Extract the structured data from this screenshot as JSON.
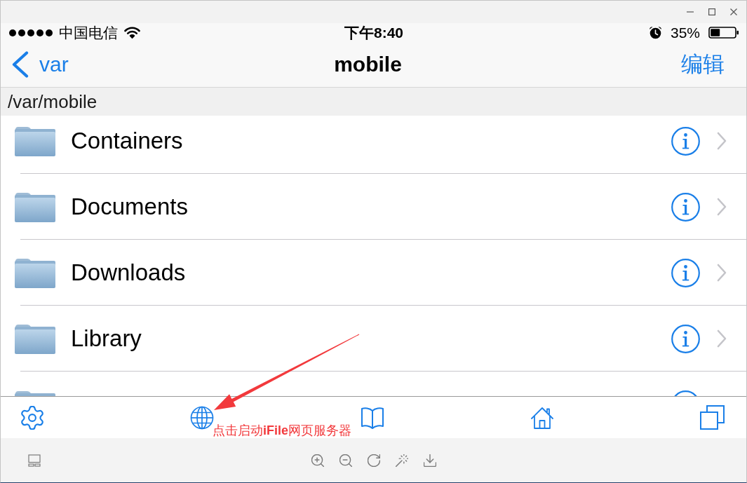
{
  "window": {
    "controls": [
      {
        "kind": "minimize"
      },
      {
        "kind": "maximize"
      },
      {
        "kind": "close"
      }
    ]
  },
  "status_bar": {
    "carrier": "中国电信",
    "time": "下午8:40",
    "battery": "35%"
  },
  "nav_bar": {
    "back": "var",
    "title": "mobile",
    "action": "编辑"
  },
  "path": "/var/mobile",
  "files": [
    {
      "kind": "folder",
      "name": "Containers"
    },
    {
      "kind": "folder",
      "name": "Documents"
    },
    {
      "kind": "folder",
      "name": "Downloads"
    },
    {
      "kind": "folder",
      "name": "Library"
    },
    {
      "kind": "peek"
    }
  ],
  "toolbar": [
    {
      "kind": "settings"
    },
    {
      "kind": "globe"
    },
    {
      "kind": "book"
    },
    {
      "kind": "home"
    },
    {
      "kind": "copy"
    }
  ],
  "annotation": {
    "text": "点击启动**iFile**网页服务器"
  },
  "simulator_bar": [
    {
      "kind": "layout"
    },
    {
      "kind": "zoom_in"
    },
    {
      "kind": "zoom_out"
    },
    {
      "kind": "rotate"
    },
    {
      "kind": "wand"
    },
    {
      "kind": "download"
    }
  ]
}
